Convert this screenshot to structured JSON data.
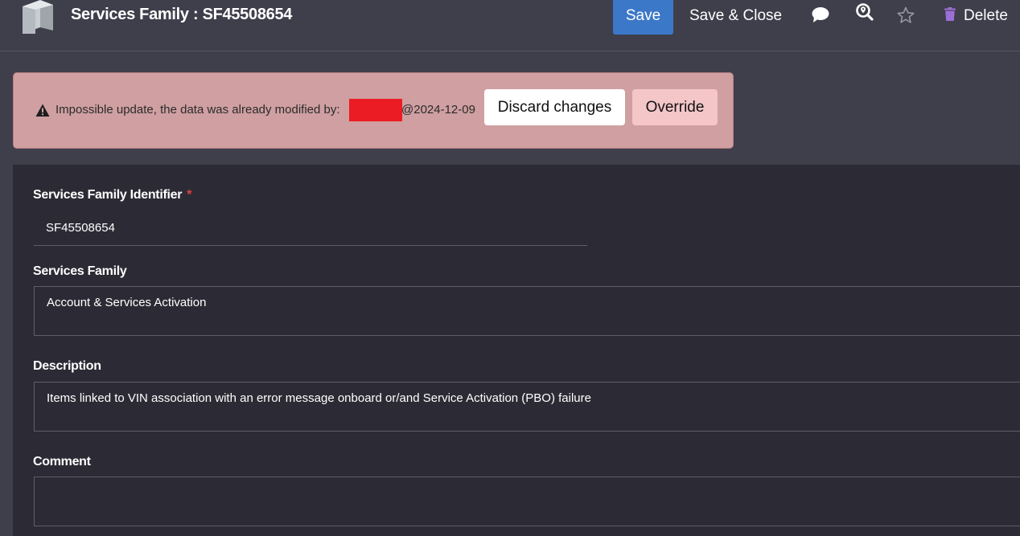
{
  "header": {
    "title": "Services Family : SF45508654",
    "save_label": "Save",
    "save_close_label": "Save & Close",
    "delete_label": "Delete"
  },
  "alert": {
    "message": "Impossible update, the data was already modified by:",
    "date": "@2024-12-09",
    "discard_label": "Discard changes",
    "override_label": "Override"
  },
  "form": {
    "identifier": {
      "label": "Services Family Identifier",
      "required_mark": "*",
      "value": "SF45508654"
    },
    "services_family": {
      "label": "Services Family",
      "value": "Account & Services Activation"
    },
    "description": {
      "label": "Description",
      "value": "Items linked to VIN association with an error message onboard or/and Service Activation (PBO) failure"
    },
    "comment": {
      "label": "Comment",
      "value": ""
    }
  },
  "icons": {
    "app": "cube-icon",
    "comment": "comment-icon",
    "search": "search-location-icon",
    "favorite": "star-icon",
    "delete": "trash-icon",
    "alert": "warning-icon"
  },
  "colors": {
    "primary": "#3c78c8",
    "alert_bg": "#cf9fa1",
    "override_bg": "#f4c6c8",
    "redaction": "#ec1c24",
    "required": "#e0413b",
    "delete_icon": "#9b6fd6"
  }
}
